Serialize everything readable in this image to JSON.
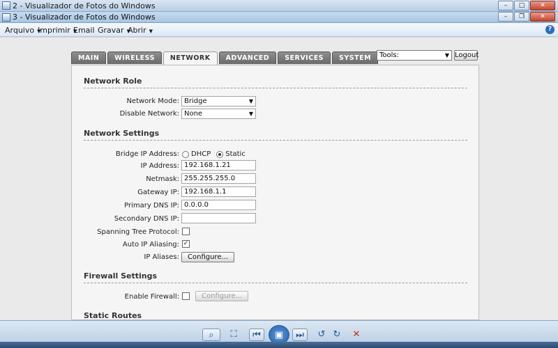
{
  "window_back": {
    "title": "2 - Visualizador de Fotos do Windows"
  },
  "window": {
    "title": "3 - Visualizador de Fotos do Windows"
  },
  "menu": [
    {
      "label": "Arquivo"
    },
    {
      "label": "Imprimir"
    },
    {
      "label": "Email"
    },
    {
      "label": "Gravar"
    },
    {
      "label": "Abrir"
    }
  ],
  "router": {
    "tabs": [
      "MAIN",
      "WIRELESS",
      "NETWORK",
      "ADVANCED",
      "SERVICES",
      "SYSTEM"
    ],
    "active_tab": "NETWORK",
    "tools": {
      "value": "Tools:"
    },
    "logout_label": "Logout",
    "network_role": {
      "title": "Network Role",
      "mode_label": "Network Mode:",
      "mode_value": "Bridge",
      "disable_label": "Disable Network:",
      "disable_value": "None"
    },
    "network_settings": {
      "title": "Network Settings",
      "bridge_ip_label": "Bridge IP Address:",
      "dhcp_label": "DHCP",
      "static_label": "Static",
      "ip_label": "IP Address:",
      "ip_value": "192.168.1.21",
      "netmask_label": "Netmask:",
      "netmask_value": "255.255.255.0",
      "gateway_label": "Gateway IP:",
      "gateway_value": "192.168.1.1",
      "dns1_label": "Primary DNS IP:",
      "dns1_value": "0.0.0.0",
      "dns2_label": "Secondary DNS IP:",
      "dns2_value": "",
      "stp_label": "Spanning Tree Protocol:",
      "stp_checked": false,
      "alias_label": "Auto IP Aliasing:",
      "alias_checked": true,
      "aliases_label": "IP Aliases:",
      "configure_label": "Configure..."
    },
    "firewall": {
      "title": "Firewall Settings",
      "enable_label": "Enable Firewall:",
      "configure_label": "Configure..."
    },
    "static_routes": {
      "title": "Static Routes"
    }
  },
  "viewer_toolbar": {
    "icons": [
      "zoom-icon",
      "fit-window-icon",
      "previous-icon",
      "slideshow-icon",
      "next-icon",
      "rotate-left-icon",
      "rotate-right-icon",
      "delete-icon"
    ]
  }
}
